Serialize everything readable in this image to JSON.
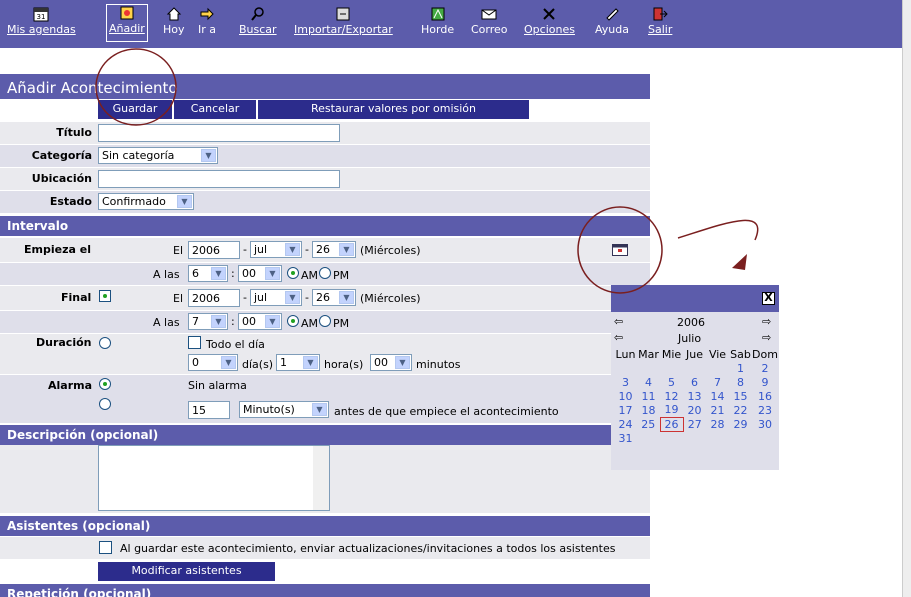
{
  "toolbar": {
    "items": [
      {
        "label": "Mis agendas",
        "icon": "calendar-icon"
      },
      {
        "label": "Añadir",
        "icon": "add-event-icon"
      },
      {
        "label": "Hoy",
        "icon": "home-icon"
      },
      {
        "label": "Ir a",
        "icon": "goto-arrow-icon"
      },
      {
        "label": "Buscar",
        "icon": "search-icon"
      },
      {
        "label": "Importar/Exportar",
        "icon": "import-export-icon"
      },
      {
        "label": "Horde",
        "icon": "horde-icon"
      },
      {
        "label": "Correo",
        "icon": "mail-icon"
      },
      {
        "label": "Opciones",
        "icon": "options-icon"
      },
      {
        "label": "Ayuda",
        "icon": "help-icon"
      },
      {
        "label": "Salir",
        "icon": "logout-icon"
      }
    ]
  },
  "page_title": "Añadir Acontecimiento",
  "buttons": {
    "save": "Guardar",
    "cancel": "Cancelar",
    "restore": "Restaurar valores por omisión"
  },
  "fields": {
    "title_label": "Título",
    "category_label": "Categoría",
    "category_value": "Sin categoría",
    "location_label": "Ubicación",
    "status_label": "Estado",
    "status_value": "Confirmado"
  },
  "interval": {
    "section": "Intervalo",
    "start_label": "Empieza el",
    "end_label": "Final",
    "el": "El",
    "alas": "A las",
    "start_year": "2006",
    "start_month": "jul",
    "start_day": "26",
    "start_weekday": "(Miércoles)",
    "start_hour": "6",
    "start_min": "00",
    "end_year": "2006",
    "end_month": "jul",
    "end_day": "26",
    "end_weekday": "(Miércoles)",
    "end_hour": "7",
    "end_min": "00",
    "am": "AM",
    "pm": "PM",
    "duration_label": "Duración",
    "all_day": "Todo el día",
    "dur_days": "0",
    "dur_days_label": "día(s)",
    "dur_hours": "1",
    "dur_hours_label": "hora(s)",
    "dur_mins": "00",
    "dur_mins_label": "minutos",
    "alarm_label": "Alarma",
    "no_alarm": "Sin alarma",
    "alarm_value": "15",
    "alarm_unit": "Minuto(s)",
    "alarm_suffix": "antes de que empiece el acontecimiento",
    "separator": "-",
    "colon": ":"
  },
  "calendar": {
    "year": "2006",
    "month": "Julio",
    "weekdays": [
      "Lun",
      "Mar",
      "Mie",
      "Jue",
      "Vie",
      "Sab",
      "Dom"
    ],
    "close": "X",
    "prev": "⇦",
    "next": "⇨",
    "weeks": [
      [
        "",
        "",
        "",
        "",
        "",
        "1",
        "2"
      ],
      [
        "3",
        "4",
        "5",
        "6",
        "7",
        "8",
        "9"
      ],
      [
        "10",
        "11",
        "12",
        "13",
        "14",
        "15",
        "16"
      ],
      [
        "17",
        "18",
        "19",
        "20",
        "21",
        "22",
        "23"
      ],
      [
        "24",
        "25",
        "26",
        "27",
        "28",
        "29",
        "30"
      ],
      [
        "31",
        "",
        "",
        "",
        "",
        "",
        ""
      ]
    ],
    "selected": "26"
  },
  "description": {
    "section": "Descripción (opcional)"
  },
  "attendees": {
    "section": "Asistentes (opcional)",
    "notify_text": "Al guardar este acontecimiento, enviar actualizaciones/invitaciones a todos los asistentes",
    "modify_button": "Modificar asistentes"
  },
  "repeat": {
    "section": "Repetición (opcional)"
  },
  "colors": {
    "header": "#5c5cab",
    "button": "#2c2c8c",
    "row": "#eaeaee",
    "annotation": "#7a1f1f"
  }
}
